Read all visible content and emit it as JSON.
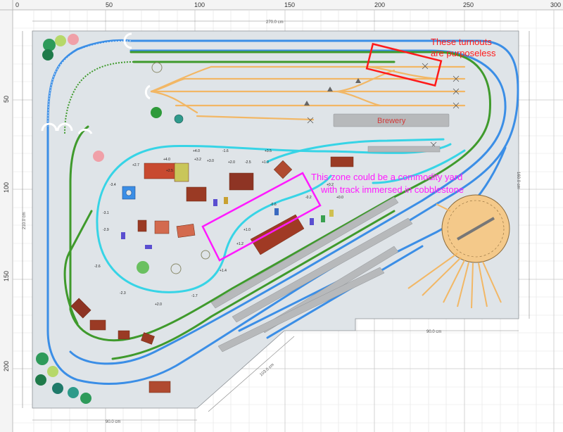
{
  "rulers": {
    "top_ticks": [
      "0",
      "50",
      "100",
      "150",
      "200",
      "250",
      "300"
    ],
    "left_ticks": [
      "50",
      "100",
      "150",
      "200"
    ]
  },
  "dimensions": {
    "top": "270.0 cm",
    "right": "160.0 cm",
    "left": "210.0 cm",
    "bottom_left": "90.0 cm",
    "bottom_right": "90.0 cm",
    "diagonal": "103.0 cm"
  },
  "labels": {
    "brewery": "Brewery"
  },
  "annotations": {
    "turnouts_line1": "These turnouts",
    "turnouts_line2": "are purposeless",
    "commodity_line1": "This zone could be a commodity yard",
    "commodity_line2": "with track immersed in cobblestone"
  },
  "grades": [
    "+4.0",
    "+4.0",
    "+3.2",
    "-1.6",
    "+2.0",
    "-2.5",
    "+3.5",
    "+1.0",
    "+2.7",
    "-3.4",
    "-3.1",
    "-2.9",
    "-2.6",
    "-2.3",
    "+2.0",
    "-1.7",
    "+1.4",
    "+1.2",
    "+1.0",
    "-0.6",
    "-0.2",
    "+0.2",
    "+0.0",
    "+3.0",
    "+2.5"
  ],
  "colors": {
    "board": "#dfe4e8",
    "track_blue": "#3b8ee6",
    "track_green": "#3f9a2c",
    "track_cyan": "#37d4e6",
    "track_yard": "#f2b765",
    "turntable": "#f4c98a",
    "annotation_red": "#ff1a1a",
    "annotation_magenta": "#ff1aff"
  }
}
